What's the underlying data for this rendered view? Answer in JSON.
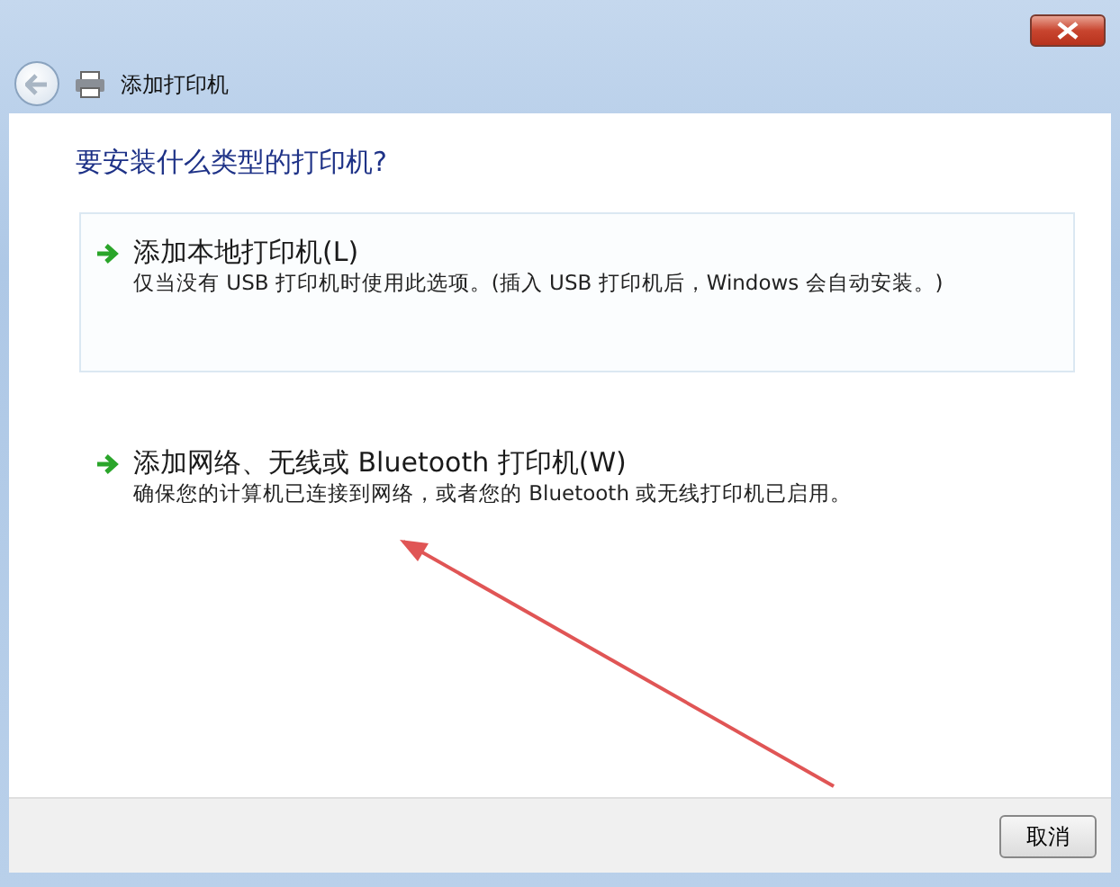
{
  "window": {
    "title": "添加打印机"
  },
  "heading": "要安装什么类型的打印机?",
  "options": [
    {
      "title": "添加本地打印机(L)",
      "description": "仅当没有 USB 打印机时使用此选项。(插入 USB 打印机后，Windows 会自动安装。)",
      "highlighted": true
    },
    {
      "title": "添加网络、无线或 Bluetooth 打印机(W)",
      "description": "确保您的计算机已连接到网络，或者您的 Bluetooth 或无线打印机已启用。",
      "highlighted": false
    }
  ],
  "annotation": {
    "kind": "arrow"
  },
  "buttons": [
    "取消"
  ]
}
